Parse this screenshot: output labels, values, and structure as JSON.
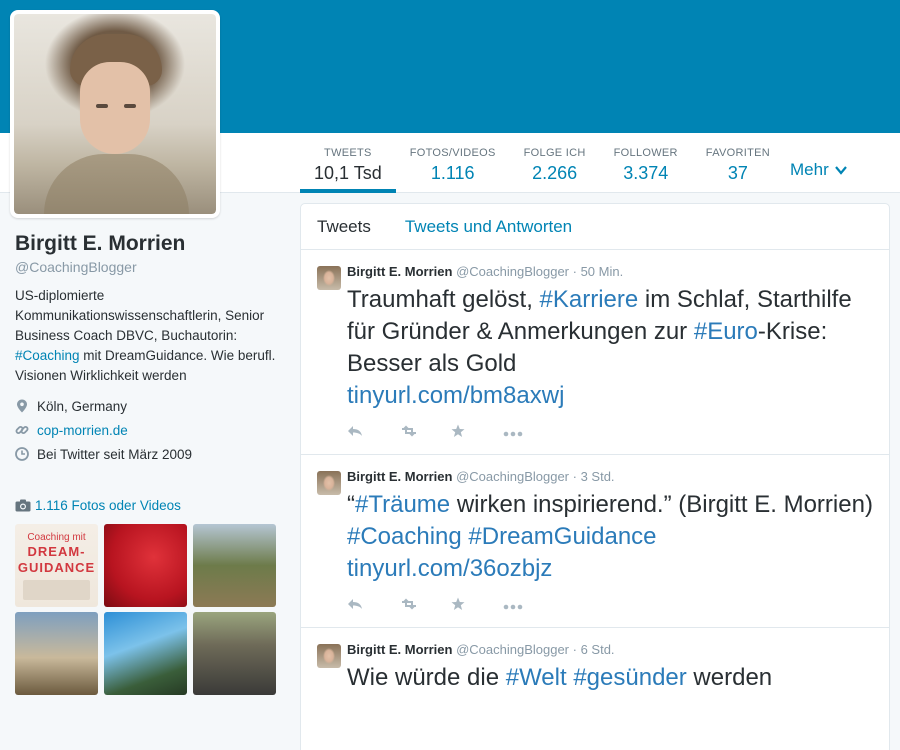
{
  "profile": {
    "name": "Birgitt E. Morrien",
    "handle": "@CoachingBlogger",
    "bio_part1": "US-diplomierte Kommunikationswissenschaftlerin, Senior Business Coach DBVC, Buchautorin: ",
    "bio_hashtag": "#Coaching",
    "bio_part2": " mit DreamGuidance. Wie berufl. Visionen Wirklichkeit werden",
    "location": "Köln, Germany",
    "website": "cop-morrien.de",
    "joined": "Bei Twitter seit März 2009",
    "photos_label": "1.116 Fotos oder Videos",
    "thumb1_text": [
      "Coaching mit",
      "DREAM-",
      "GUIDANCE"
    ]
  },
  "stats": [
    {
      "label": "TWEETS",
      "value": "10,1 Tsd"
    },
    {
      "label": "FOTOS/VIDEOS",
      "value": "1.116"
    },
    {
      "label": "FOLGE ICH",
      "value": "2.266"
    },
    {
      "label": "FOLLOWER",
      "value": "3.374"
    },
    {
      "label": "FAVORITEN",
      "value": "37"
    }
  ],
  "more_label": "Mehr",
  "tabs": {
    "tweets": "Tweets",
    "replies": "Tweets und Antworten"
  },
  "tweets": [
    {
      "author": "Birgitt E. Morrien",
      "handle": "@CoachingBlogger",
      "time": "· 50 Min.",
      "parts": [
        "Traumhaft gelöst, ",
        "#Karriere",
        " im Schlaf, Starthilfe für Gründer & Anmerkungen zur ",
        "#Euro",
        "-Krise: Besser als Gold",
        "tinyurl.com/bm8axwj"
      ]
    },
    {
      "author": "Birgitt E. Morrien",
      "handle": "@CoachingBlogger",
      "time": "· 3 Std.",
      "parts": [
        "“",
        "#Träume",
        " wirken inspirierend.” (Birgitt E. Morrien)",
        "#Coaching",
        " ",
        "#DreamGuidance",
        "tinyurl.com/36ozbjz"
      ]
    },
    {
      "author": "Birgitt E. Morrien",
      "handle": "@CoachingBlogger",
      "time": "· 6 Std.",
      "parts": [
        "Wie würde die ",
        "#Welt",
        " ",
        "#gesünder",
        " werden"
      ]
    }
  ],
  "icons": {
    "reply": "reply-icon",
    "retweet": "retweet-icon",
    "favorite": "star-icon",
    "more": "more-dots-icon"
  },
  "colors": {
    "header": "#0084b4",
    "link": "#0084b4",
    "hashtag": "#2b7bb9",
    "muted": "#8899a6"
  }
}
